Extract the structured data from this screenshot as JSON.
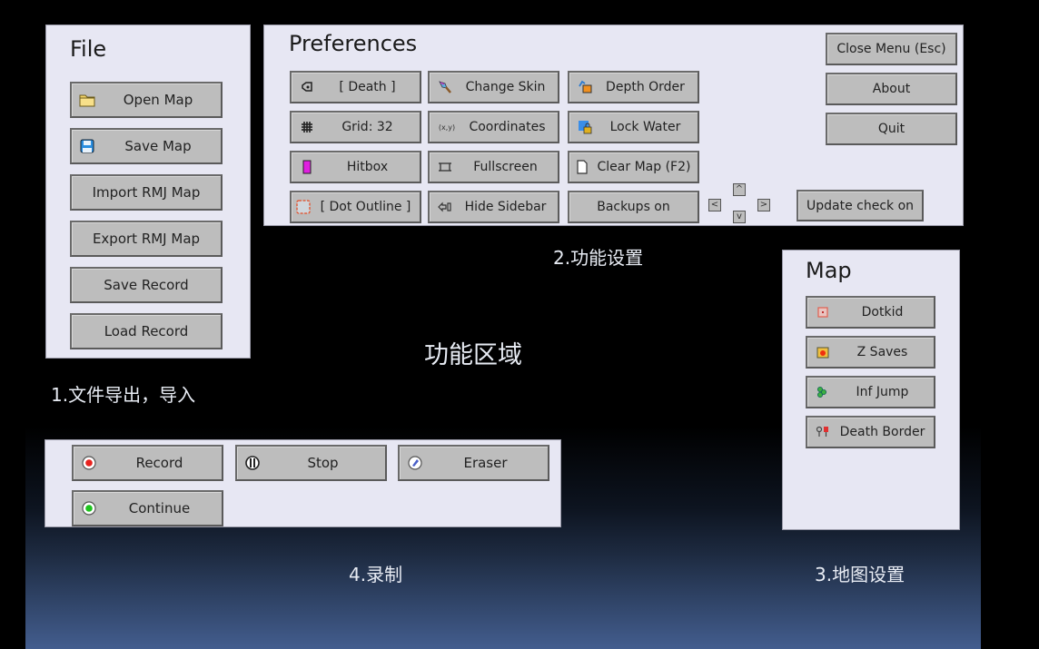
{
  "file_panel": {
    "title": "File",
    "buttons": [
      {
        "label": "Open Map",
        "icon": "folder-icon"
      },
      {
        "label": "Save Map",
        "icon": "floppy-disk-icon"
      },
      {
        "label": "Import RMJ Map"
      },
      {
        "label": "Export RMJ Map"
      },
      {
        "label": "Save Record"
      },
      {
        "label": "Load Record"
      }
    ]
  },
  "preferences_panel": {
    "title": "Preferences",
    "col1": [
      {
        "label": "[ Death ]",
        "icon": "death-icon"
      },
      {
        "label": "Grid: 32",
        "icon": "grid-icon"
      },
      {
        "label": "Hitbox",
        "icon": "hitbox-icon"
      },
      {
        "label": "[ Dot Outline ]",
        "icon": "dot-outline-icon"
      }
    ],
    "col2": [
      {
        "label": "Change Skin",
        "icon": "brush-icon"
      },
      {
        "label": "Coordinates",
        "icon": "coordinates-icon",
        "icon_text": "(x,y)"
      },
      {
        "label": "Fullscreen",
        "icon": "fullscreen-icon"
      },
      {
        "label": "Hide Sidebar",
        "icon": "hide-sidebar-icon"
      }
    ],
    "col3": [
      {
        "label": "Depth Order",
        "icon": "depth-order-icon"
      },
      {
        "label": "Lock Water",
        "icon": "lock-water-icon"
      },
      {
        "label": "Clear Map (F2)",
        "icon": "page-icon"
      },
      {
        "label": "Backups on"
      }
    ],
    "arrows": {
      "up": "^",
      "down": "v",
      "left": "<",
      "right": ">"
    },
    "update_check": "Update check on",
    "right_buttons": [
      {
        "label": "Close Menu (Esc)"
      },
      {
        "label": "About"
      },
      {
        "label": "Quit"
      }
    ]
  },
  "map_panel": {
    "title": "Map",
    "buttons": [
      {
        "label": "Dotkid",
        "icon": "dotkid-icon"
      },
      {
        "label": "Z Saves",
        "icon": "save-block-icon"
      },
      {
        "label": "Inf Jump",
        "icon": "inf-jump-icon"
      },
      {
        "label": "Death Border",
        "icon": "death-border-icon"
      }
    ]
  },
  "record_panel": {
    "buttons": [
      {
        "label": "Record",
        "icon": "record-icon"
      },
      {
        "label": "Stop",
        "icon": "stop-icon"
      },
      {
        "label": "Eraser",
        "icon": "eraser-icon"
      },
      {
        "label": "Continue",
        "icon": "continue-icon"
      }
    ]
  },
  "captions": {
    "file": "1.文件导出，导入",
    "preferences": "2.功能设置",
    "center": "功能区域",
    "map": "3.地图设置",
    "record": "4.录制"
  },
  "colors": {
    "panel_bg": "#e7e7f3",
    "button_bg": "#bdbdbd",
    "record_red": "#e8221e",
    "continue_green": "#1ec41e",
    "hitbox_magenta": "#e020e0"
  }
}
